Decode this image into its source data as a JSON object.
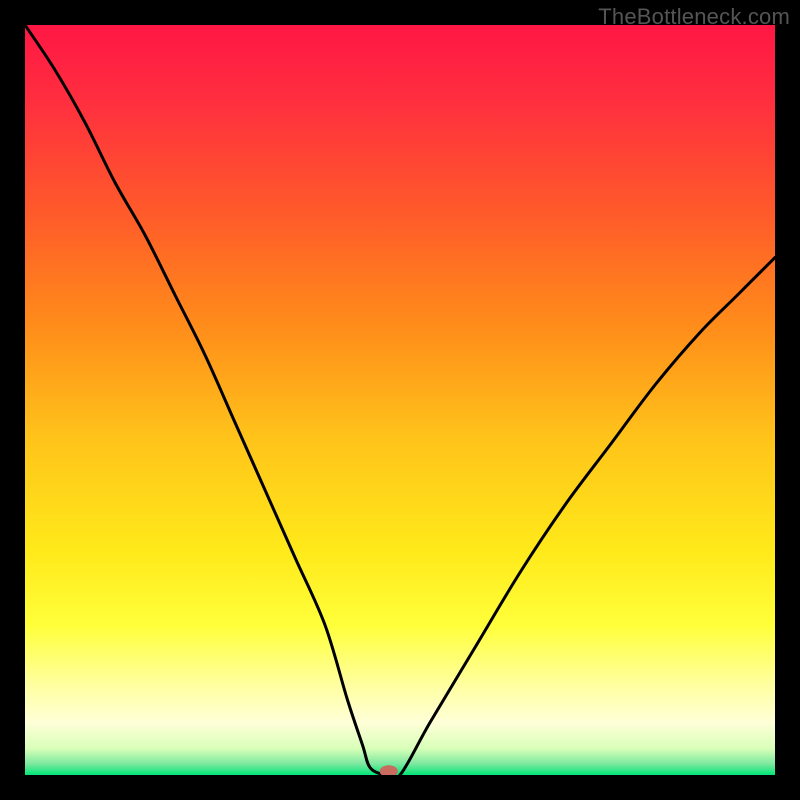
{
  "watermark": "TheBottleneck.com",
  "chart_data": {
    "type": "line",
    "title": "",
    "xlabel": "",
    "ylabel": "",
    "xlim": [
      0,
      100
    ],
    "ylim": [
      0,
      100
    ],
    "background_gradient": {
      "stops": [
        {
          "offset": 0.0,
          "color": "#ff1744"
        },
        {
          "offset": 0.1,
          "color": "#ff2e3f"
        },
        {
          "offset": 0.25,
          "color": "#ff5a2a"
        },
        {
          "offset": 0.4,
          "color": "#ff8c1a"
        },
        {
          "offset": 0.55,
          "color": "#ffc31a"
        },
        {
          "offset": 0.7,
          "color": "#ffe91a"
        },
        {
          "offset": 0.8,
          "color": "#ffff3a"
        },
        {
          "offset": 0.88,
          "color": "#ffffa0"
        },
        {
          "offset": 0.93,
          "color": "#ffffd8"
        },
        {
          "offset": 0.965,
          "color": "#d8ffb8"
        },
        {
          "offset": 0.985,
          "color": "#7ce8a0"
        },
        {
          "offset": 1.0,
          "color": "#00e676"
        }
      ]
    },
    "series": [
      {
        "name": "bottleneck-curve",
        "x": [
          0,
          4,
          8,
          12,
          16,
          20,
          24,
          28,
          32,
          36,
          40,
          43,
          45,
          46,
          48,
          50,
          54,
          60,
          66,
          72,
          78,
          84,
          90,
          95,
          100
        ],
        "y": [
          100,
          94,
          87,
          79,
          72,
          64,
          56,
          47,
          38,
          29,
          20,
          10,
          4,
          1,
          0,
          0,
          7,
          17,
          27,
          36,
          44,
          52,
          59,
          64,
          69
        ]
      }
    ],
    "marker": {
      "x": 48.5,
      "y": 0.5,
      "color": "#c96b5e",
      "rx": 9,
      "ry": 6
    }
  }
}
